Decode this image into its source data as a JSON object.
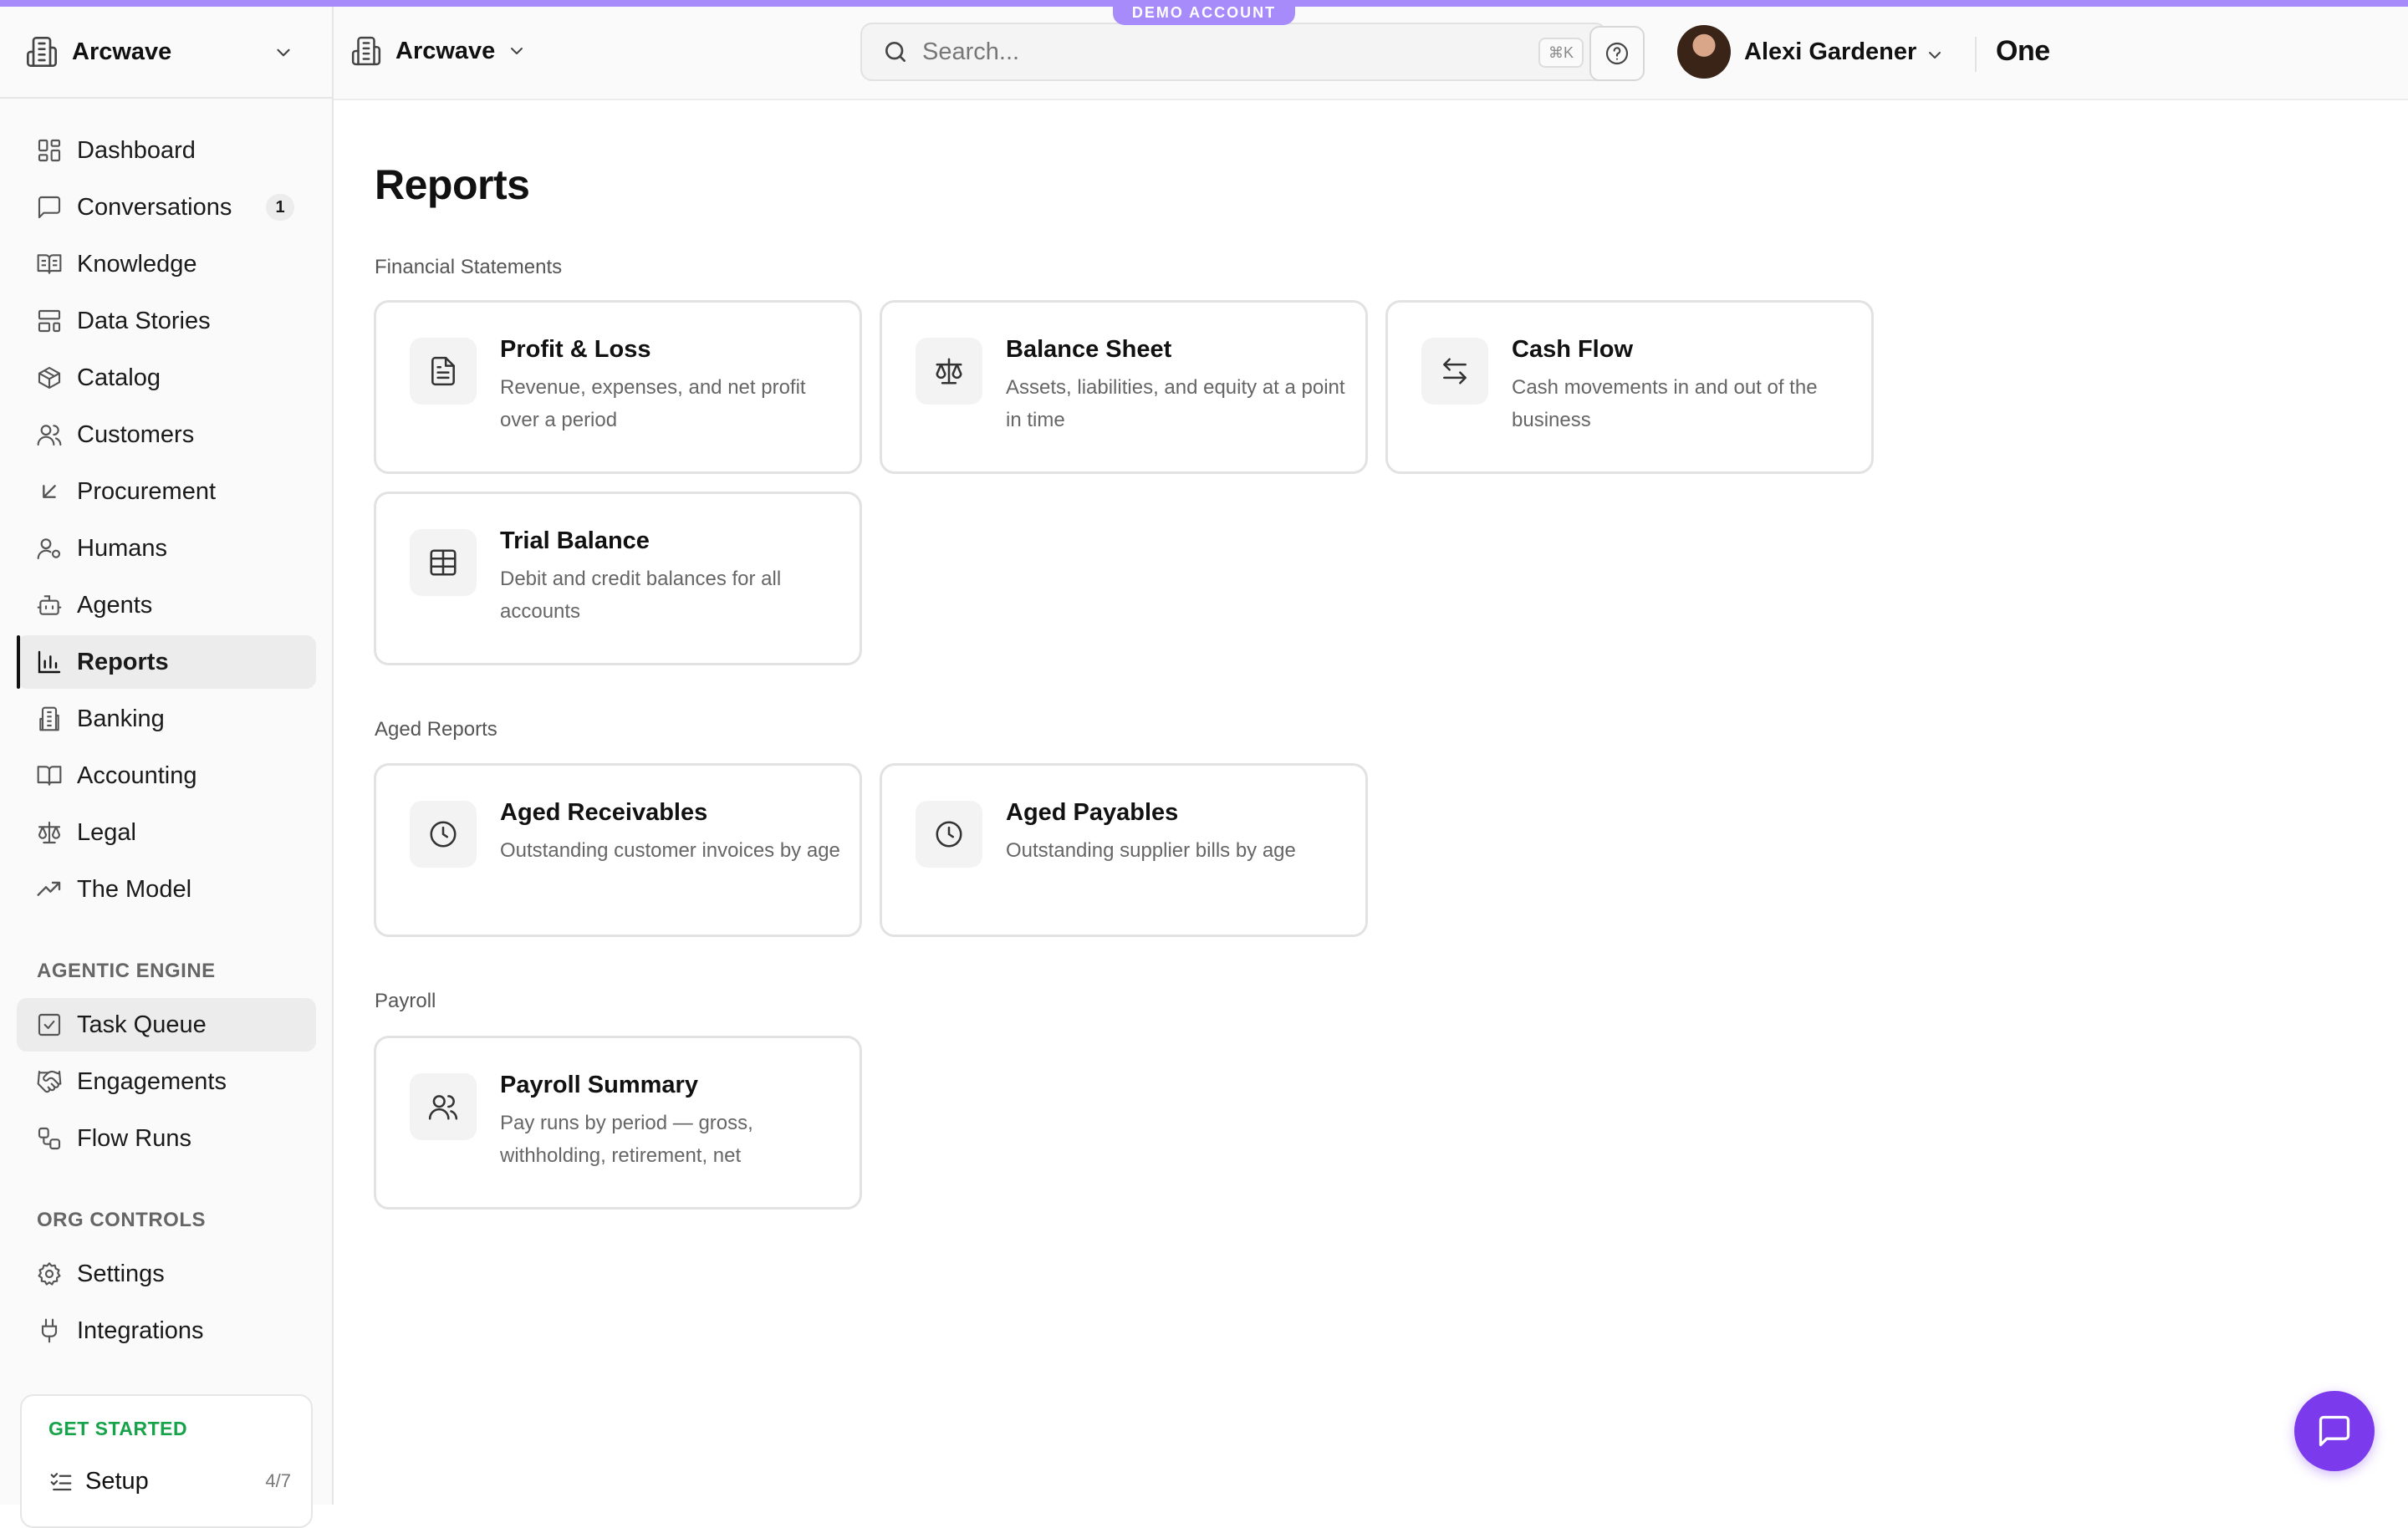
{
  "banner": {
    "label": "DEMO ACCOUNT",
    "color": "#a78bfa"
  },
  "sidebar": {
    "workspace": "Arcwave",
    "items": [
      {
        "label": "Dashboard",
        "icon": "layout-dashboard-icon"
      },
      {
        "label": "Conversations",
        "icon": "message-square-icon",
        "badge": "1"
      },
      {
        "label": "Knowledge",
        "icon": "book-open-text-icon"
      },
      {
        "label": "Data Stories",
        "icon": "layout-template-icon"
      },
      {
        "label": "Catalog",
        "icon": "package-icon"
      },
      {
        "label": "Customers",
        "icon": "users-icon"
      },
      {
        "label": "Procurement",
        "icon": "arrow-down-left-icon"
      },
      {
        "label": "Humans",
        "icon": "user-cog-icon"
      },
      {
        "label": "Agents",
        "icon": "bot-icon"
      },
      {
        "label": "Reports",
        "icon": "bar-chart-icon",
        "active": true
      },
      {
        "label": "Banking",
        "icon": "landmark-icon"
      },
      {
        "label": "Accounting",
        "icon": "book-icon"
      },
      {
        "label": "Legal",
        "icon": "scale-icon"
      },
      {
        "label": "The Model",
        "icon": "trending-up-icon"
      }
    ],
    "agentic_engine": {
      "heading": "AGENTIC ENGINE",
      "items": [
        {
          "label": "Task Queue",
          "icon": "square-check-icon"
        },
        {
          "label": "Engagements",
          "icon": "handshake-icon"
        },
        {
          "label": "Flow Runs",
          "icon": "workflow-icon"
        }
      ]
    },
    "org_controls": {
      "heading": "ORG CONTROLS",
      "items": [
        {
          "label": "Settings",
          "icon": "gear-icon"
        },
        {
          "label": "Integrations",
          "icon": "plug-icon"
        }
      ]
    },
    "get_started": {
      "heading": "GET STARTED",
      "setup_label": "Setup",
      "setup_progress": "4/7"
    }
  },
  "header": {
    "org_name": "Arcwave",
    "search": {
      "placeholder": "Search...",
      "shortcut": "⌘K"
    },
    "user_name": "Alexi Gardener",
    "brand": "One"
  },
  "main": {
    "title": "Reports",
    "groups": [
      {
        "label": "Financial Statements",
        "cards": [
          {
            "title": "Profit & Loss",
            "desc": "Revenue, expenses, and net profit over a period",
            "icon": "file-text-icon"
          },
          {
            "title": "Balance Sheet",
            "desc": "Assets, liabilities, and equity at a point in time",
            "icon": "scale-icon"
          },
          {
            "title": "Cash Flow",
            "desc": "Cash movements in and out of the business",
            "icon": "arrow-left-right-icon"
          },
          {
            "title": "Trial Balance",
            "desc": "Debit and credit balances for all accounts",
            "icon": "table-icon"
          }
        ]
      },
      {
        "label": "Aged Reports",
        "cards": [
          {
            "title": "Aged Receivables",
            "desc": "Outstanding customer invoices by age",
            "icon": "clock-icon"
          },
          {
            "title": "Aged Payables",
            "desc": "Outstanding supplier bills by age",
            "icon": "clock-icon"
          }
        ]
      },
      {
        "label": "Payroll",
        "cards": [
          {
            "title": "Payroll Summary",
            "desc": "Pay runs by period — gross, withholding, retirement, net",
            "icon": "users-icon"
          }
        ]
      }
    ]
  },
  "colors": {
    "accent": "#7c3aed",
    "banner": "#a78bfa",
    "success": "#16a34a"
  }
}
